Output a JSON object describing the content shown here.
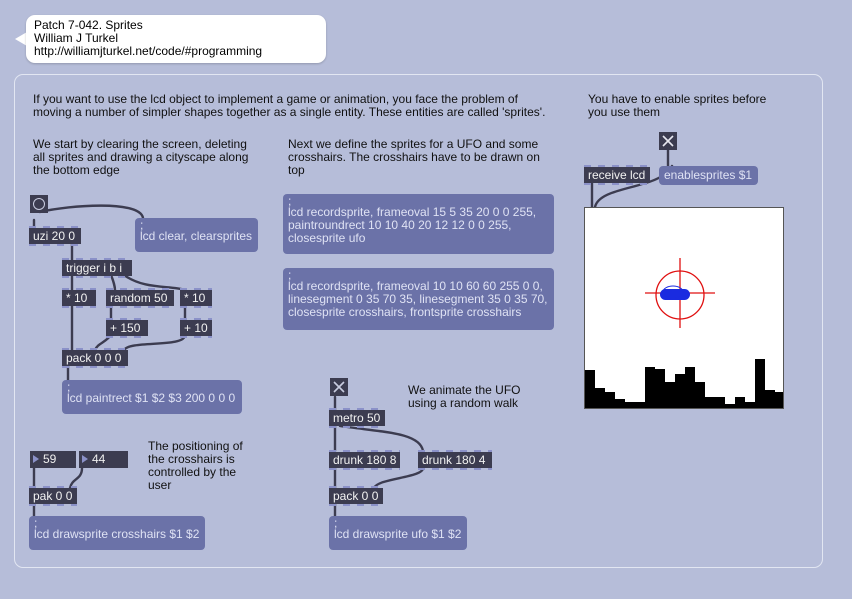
{
  "header": {
    "title": "Patch 7-042. Sprites",
    "author": "William J Turkel",
    "url": "http://williamjturkel.net/code/#programming"
  },
  "comments": {
    "intro": "If you want to use the lcd object to implement a game or animation, you face the problem of moving a number of simpler shapes together as a single entity. These entities are called 'sprites'.",
    "enable": "You have to enable sprites before you use them",
    "clear": "We start by clearing the screen, deleting all sprites and drawing a cityscape along the bottom edge",
    "define": "Next we define the sprites for a UFO and some crosshairs. The crosshairs have to be drawn on top",
    "animate": "We animate the UFO using a random walk",
    "position": "The positioning of the crosshairs is controlled by the user"
  },
  "objects": {
    "uzi": "uzi 20 0",
    "trigger": "trigger i b i",
    "mul10a": "* 10",
    "random50": "random 50",
    "mul10b": "* 10",
    "plus150": "+ 150",
    "plus10": "+ 10",
    "pack000": "pack 0 0 0",
    "metro": "metro 50",
    "drunk8": "drunk 180 8",
    "drunk4": "drunk 180 4",
    "pack00": "pack 0 0",
    "pak00": "pak 0 0",
    "receive": "receive lcd"
  },
  "messages": {
    "clear": "lcd clear, clearsprites",
    "paintrect": "lcd paintrect $1 $2 $3 200 0 0 0",
    "ufo_sprite": "lcd recordsprite, frameoval 15 5 35 20 0 0 255, paintroundrect 10 10 40 20 12 12 0 0 255, closesprite ufo",
    "crosshairs_sprite": "lcd recordsprite, frameoval 10 10 60 60 255 0 0, linesegment 0 35 70 35, linesegment 35 0 35 70, closesprite crosshairs, frontsprite crosshairs",
    "enablesprites": "enablesprites $1",
    "draw_crosshairs": "lcd drawsprite crosshairs $1 $2",
    "draw_ufo": "lcd drawsprite ufo $1 $2",
    "semicolon": ";"
  },
  "number_boxes": {
    "x": "59",
    "y": "44"
  },
  "lcd": {
    "crosshair_color": "#e01010",
    "ufo_color": "#1a2be0",
    "city_heights": [
      37,
      19,
      15,
      8,
      5,
      5,
      40,
      38,
      25,
      33,
      40,
      25,
      10,
      10,
      3,
      10,
      5,
      48,
      17,
      15
    ]
  },
  "colors": {
    "background": "#b6bdd9",
    "object_fill": "#3c3c50",
    "message_fill": "#6b72a8",
    "wire": "#3c3c50"
  }
}
